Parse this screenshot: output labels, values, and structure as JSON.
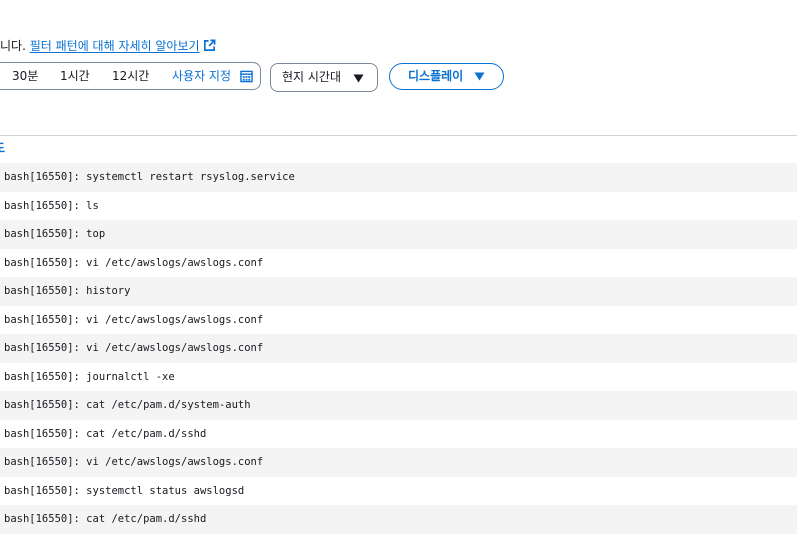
{
  "help": {
    "prefix": "니다. ",
    "link": "필터 패턴에 대해 자세히 알아보기"
  },
  "time_range": {
    "options": [
      "30분",
      "1시간",
      "12시간"
    ],
    "custom": "사용자 지정"
  },
  "timezone": {
    "label": "현지 시간대"
  },
  "display": {
    "label": "디스플레이"
  },
  "table": {
    "column_header": "도"
  },
  "logs": [
    "bash[16550]: systemctl restart rsyslog.service",
    "bash[16550]: ls",
    "bash[16550]: top",
    "bash[16550]: vi /etc/awslogs/awslogs.conf",
    "bash[16550]: history",
    "bash[16550]: vi /etc/awslogs/awslogs.conf",
    "bash[16550]: vi /etc/awslogs/awslogs.conf",
    "bash[16550]: journalctl -xe",
    "bash[16550]: cat /etc/pam.d/system-auth",
    "bash[16550]: cat /etc/pam.d/sshd",
    "bash[16550]: vi /etc/awslogs/awslogs.conf",
    "bash[16550]: systemctl status awslogsd",
    "bash[16550]: cat /etc/pam.d/sshd"
  ],
  "colors": {
    "link": "#0972d3",
    "text": "#16191f",
    "row_stripe": "#f4f4f4",
    "border": "#7d8998"
  }
}
